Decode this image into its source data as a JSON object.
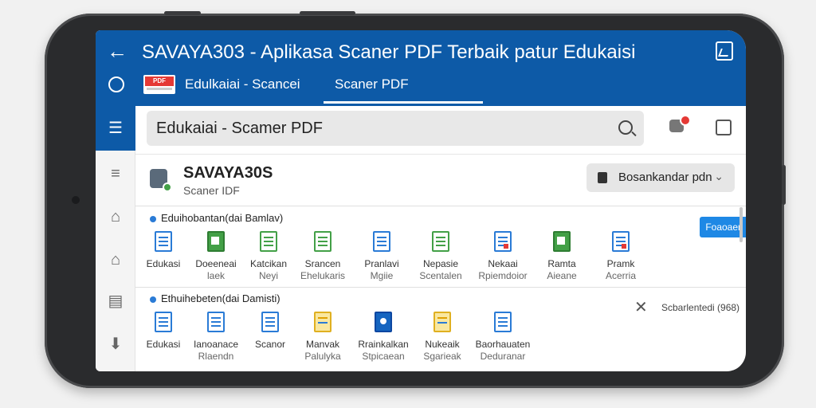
{
  "appbar": {
    "title": "SAVAYA303 - Aplikasa Scaner PDF Terbaik patur Edukaisi",
    "pdf_badge": "PDF",
    "breadcrumb": "Edulkaiai - Scancei",
    "tab": "Scaner PDF"
  },
  "search": {
    "value": "Edukaiai - Scamer PDF"
  },
  "header": {
    "app_name": "SAVAYA30S",
    "app_sub": "Scaner IDF",
    "sort_label": "Bosankandar pdn"
  },
  "section1": {
    "heading": "Eduihobantan(dai Bamlav)",
    "action_label": "Foaoaen",
    "tools": [
      {
        "line1": "Edukasi",
        "line2": "",
        "icon": "document-icon"
      },
      {
        "line1": "Doeeneai",
        "line2": "laek",
        "icon": "scan-icon"
      },
      {
        "line1": "Katcikan",
        "line2": "Neyi",
        "icon": "doc-green-icon"
      },
      {
        "line1": "Srancen",
        "line2": "Ehelukaris",
        "icon": "doc-green-icon"
      },
      {
        "line1": "Pranlavi",
        "line2": "Mgiie",
        "icon": "doc-blue-icon"
      },
      {
        "line1": "Nepasie",
        "line2": "Scentalen",
        "icon": "edit-icon"
      },
      {
        "line1": "Nekaai",
        "line2": "Rpiemdoior",
        "icon": "pdf-icon"
      },
      {
        "line1": "Ramta",
        "line2": "Aieane",
        "icon": "image-icon"
      },
      {
        "line1": "Pramk",
        "line2": "Acerria",
        "icon": "doc-red-icon"
      }
    ]
  },
  "section2": {
    "heading": "Ethuihebeten(dai Damisti)",
    "result_text": "Scbarlentedi (968)",
    "tools": [
      {
        "line1": "Edukasi",
        "line2": "",
        "icon": "document-icon"
      },
      {
        "line1": "Ianoanace",
        "line2": "Rlaendn",
        "icon": "table-icon"
      },
      {
        "line1": "Scanor",
        "line2": "",
        "icon": "document-icon"
      },
      {
        "line1": "Manvak",
        "line2": "Palulyka",
        "icon": "layers-icon"
      },
      {
        "line1": "Rrainkalkan",
        "line2": "Stpicaean",
        "icon": "search-doc-icon"
      },
      {
        "line1": "Nukeaik",
        "line2": "Sgarieak",
        "icon": "list-icon"
      },
      {
        "line1": "Baorhauaten",
        "line2": "Deduranar",
        "icon": "lock-doc-icon"
      }
    ]
  },
  "colors": {
    "primary": "#0d5aa7",
    "accent": "#1e88e5",
    "badge_red": "#e53935",
    "success_green": "#43a047"
  }
}
